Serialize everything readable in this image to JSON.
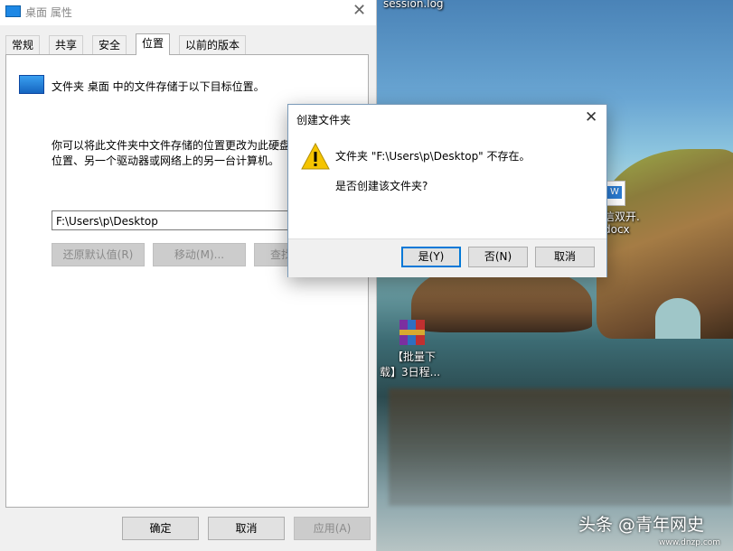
{
  "desktop": {
    "session_label": "session.log",
    "doc_label_line1": "信双开.",
    "doc_label_line2": "docx",
    "rar_label_line1": "【批量下",
    "rar_label_line2": "载】3日程..."
  },
  "properties_window": {
    "title": "桌面 属性",
    "tabs": [
      "常规",
      "共享",
      "安全",
      "位置",
      "以前的版本"
    ],
    "active_tab": "位置",
    "description": "文件夹 桌面 中的文件存储于以下目标位置。",
    "info_line1": "你可以将此文件夹中文件存储的位置更改为此硬盘",
    "info_line2": "位置、另一个驱动器或网络上的另一台计算机。",
    "path_value": "F:\\Users\\p\\Desktop",
    "restore_default_label": "还原默认值(R)",
    "move_label": "移动(M)...",
    "find_target_label": "查找",
    "ok_label": "确定",
    "cancel_label": "取消",
    "apply_label": "应用(A)"
  },
  "dialog": {
    "title": "创建文件夹",
    "message": "文件夹 \"F:\\Users\\p\\Desktop\" 不存在。",
    "question": "是否创建该文件夹?",
    "yes_label": "是(Y)",
    "no_label": "否(N)",
    "cancel_label": "取消"
  },
  "watermark": {
    "text": "头条 @青年网史",
    "site": "www.dnzp.com"
  },
  "colors": {
    "accent": "#0078d7",
    "warning": "#f5c400"
  }
}
